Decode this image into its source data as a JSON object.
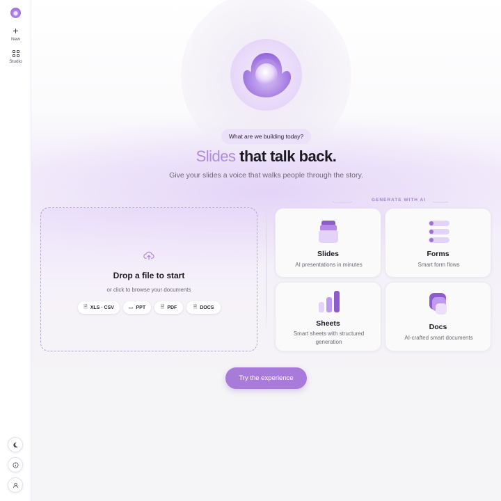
{
  "sidebar": {
    "new_label": "New",
    "new_glyph": "+",
    "studio_label": "Studio"
  },
  "hero": {
    "prompt_pill": "What are we building today?",
    "headline_accent": "Slides",
    "headline_rest": " that talk back.",
    "subline": "Give your slides a voice that walks people through the story."
  },
  "dropzone": {
    "title": "Drop a file to start",
    "subtitle": "or click to browse your documents",
    "chips": [
      "XLS · CSV",
      "PPT",
      "PDF",
      "DOCS"
    ]
  },
  "generate": {
    "label": "GENERATE WITH AI",
    "cards": [
      {
        "title": "Slides",
        "subtitle": "AI presentations in minutes"
      },
      {
        "title": "Forms",
        "subtitle": "Smart form flows"
      },
      {
        "title": "Sheets",
        "subtitle": "Smart sheets with structured generation"
      },
      {
        "title": "Docs",
        "subtitle": "AI-crafted smart documents"
      }
    ]
  },
  "cta": {
    "label": "Try the experience"
  },
  "colors": {
    "accent": "#a87ada",
    "accent_light": "#ece1fa",
    "text": "#1c1a22"
  }
}
